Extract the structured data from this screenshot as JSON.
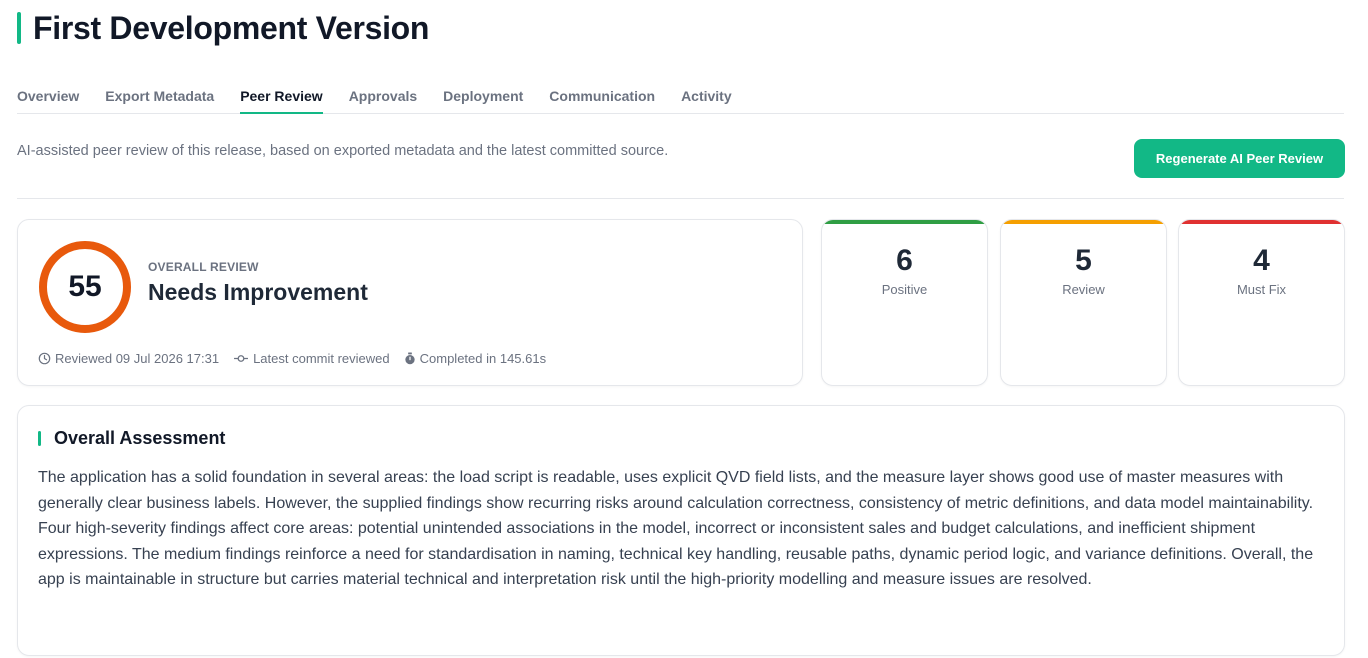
{
  "page": {
    "title": "First Development Version"
  },
  "tabs": [
    {
      "label": "Overview",
      "active": false
    },
    {
      "label": "Export Metadata",
      "active": false
    },
    {
      "label": "Peer Review",
      "active": true
    },
    {
      "label": "Approvals",
      "active": false
    },
    {
      "label": "Deployment",
      "active": false
    },
    {
      "label": "Communication",
      "active": false
    },
    {
      "label": "Activity",
      "active": false
    }
  ],
  "intro_text": "AI-assisted peer review of this release, based on exported metadata and the latest committed source.",
  "regenerate_button": "Regenerate AI Peer Review",
  "overall": {
    "score": "55",
    "score_fraction": 0.55,
    "label": "OVERALL REVIEW",
    "status": "Needs Improvement",
    "ring_color": "#e8590c",
    "meta": {
      "reviewed": "Reviewed 09 Jul 2026 17:31",
      "commit": "Latest commit reviewed",
      "completed": "Completed in 145.61s"
    }
  },
  "stats": [
    {
      "value": "6",
      "label": "Positive",
      "color": "#2f9e44"
    },
    {
      "value": "5",
      "label": "Review",
      "color": "#f59f00"
    },
    {
      "value": "4",
      "label": "Must Fix",
      "color": "#e03131"
    }
  ],
  "assessment": {
    "title": "Overall Assessment",
    "body": "The application has a solid foundation in several areas: the load script is readable, uses explicit QVD field lists, and the measure layer shows good use of master measures with generally clear business labels. However, the supplied findings show recurring risks around calculation correctness, consistency of metric definitions, and data model maintainability. Four high-severity findings affect core areas: potential unintended associations in the model, incorrect or inconsistent sales and budget calculations, and inefficient shipment expressions. The medium findings reinforce a need for standardisation in naming, technical key handling, reusable paths, dynamic period logic, and variance definitions. Overall, the app is maintainable in structure but carries material technical and interpretation risk until the high-priority modelling and measure issues are resolved."
  },
  "colors": {
    "accent": "#12b886"
  }
}
